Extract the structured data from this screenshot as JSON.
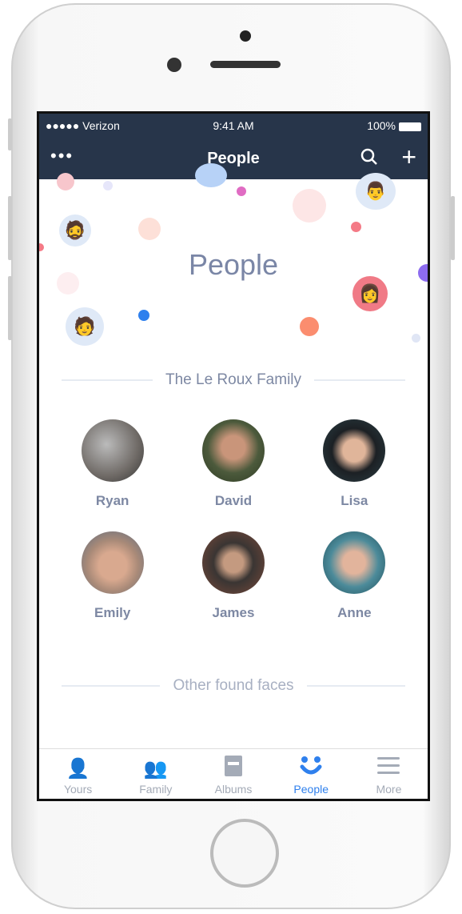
{
  "status": {
    "carrier": "●●●●● Verizon",
    "time": "9:41 AM",
    "battery": "100%"
  },
  "nav": {
    "title": "People",
    "more": "•••",
    "search": "⚲",
    "add": "+"
  },
  "hero": {
    "title": "People"
  },
  "family": {
    "title": "The Le Roux Family",
    "members": [
      {
        "name": "Ryan",
        "color": "#6f6a66"
      },
      {
        "name": "David",
        "color": "#4c5a3c"
      },
      {
        "name": "Lisa",
        "color": "#2b3f45"
      },
      {
        "name": "Emily",
        "color": "#a98a78"
      },
      {
        "name": "James",
        "color": "#5a4438"
      },
      {
        "name": "Anne",
        "color": "#4c8b9a"
      }
    ]
  },
  "other": {
    "title": "Other found faces"
  },
  "tabs": [
    {
      "label": "Yours",
      "icon": "person-icon"
    },
    {
      "label": "Family",
      "icon": "family-icon"
    },
    {
      "label": "Albums",
      "icon": "album-icon"
    },
    {
      "label": "People",
      "icon": "smiley-icon",
      "active": true
    },
    {
      "label": "More",
      "icon": "menu-icon"
    }
  ],
  "colors": {
    "nav": "#27354a",
    "accent": "#2f80ed",
    "text": "#7d88a3"
  }
}
